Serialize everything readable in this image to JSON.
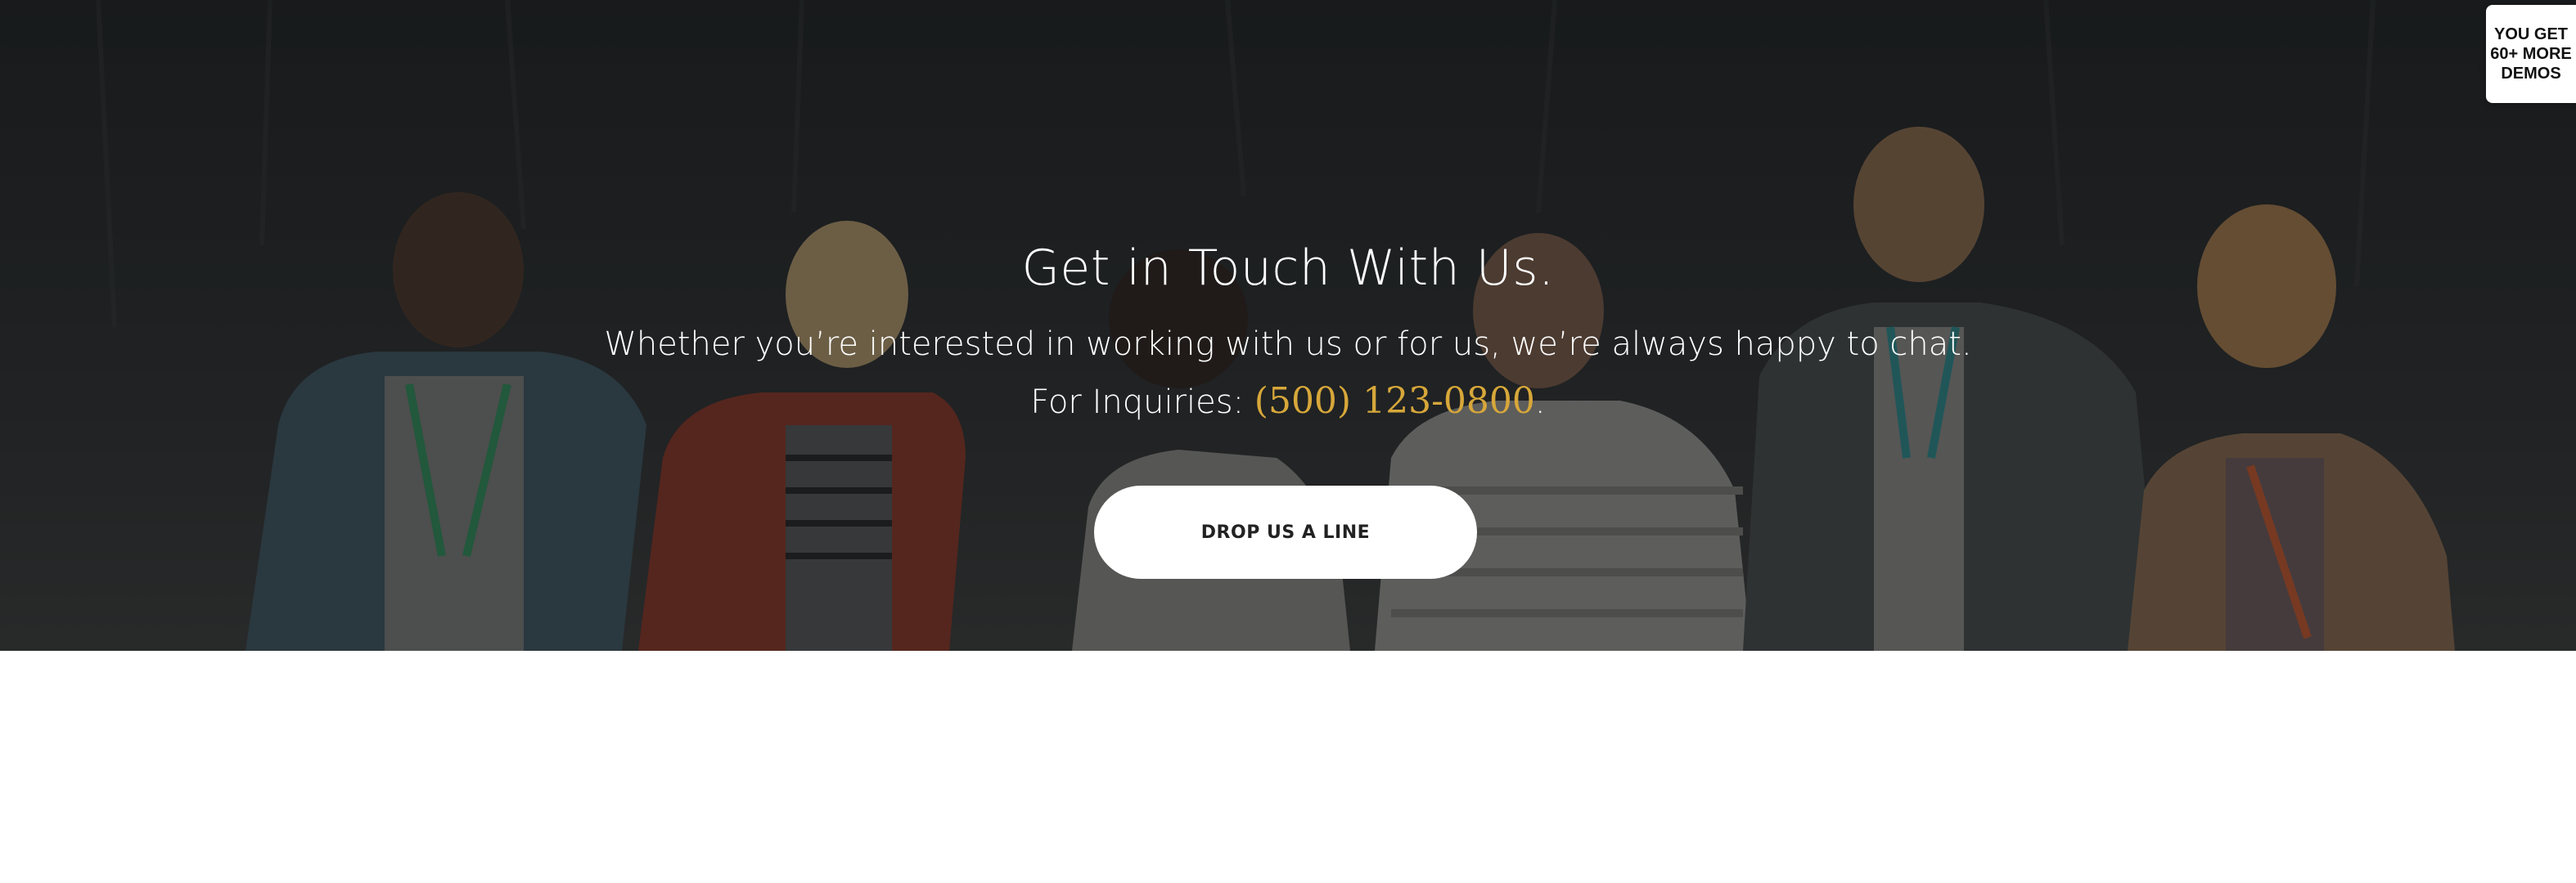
{
  "hero": {
    "title": "Get in Touch With Us.",
    "line1": "Whether you’re interested in working with us or for us, we’re always happy to chat.",
    "inquiries_label": "For Inquiries: ",
    "phone": "(500) 123-0800",
    "trailing_period": ".",
    "button_label": "DROP US A LINE"
  },
  "demos_badge": {
    "label": "YOU GET\n60+ MORE\nDEMOS"
  },
  "colors": {
    "accent": "#d7a73a",
    "button_bg": "#ffffff",
    "hero_bg": "#232526"
  }
}
